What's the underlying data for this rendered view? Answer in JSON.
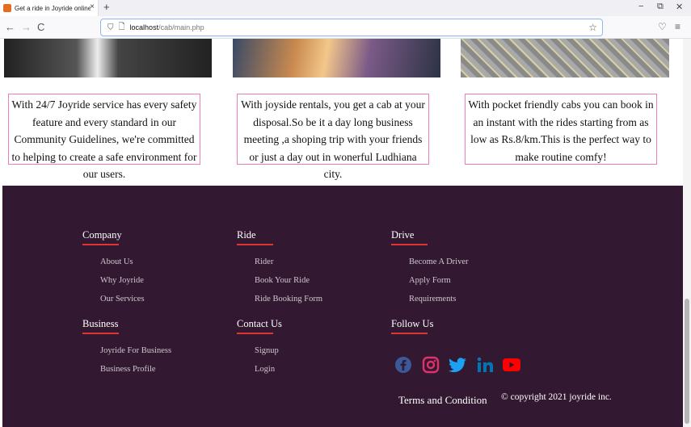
{
  "browser": {
    "tab_title": "Get a ride in Joyride online cab",
    "tab_close": "×",
    "new_tab": "+",
    "url_host": "localhost",
    "url_path": "/cab/main.php",
    "back": "←",
    "forward": "→",
    "reload": "C",
    "star": "☆",
    "minimize": "−",
    "restore": "⧉",
    "close": "✕",
    "pocket": "♡",
    "menu": "≡"
  },
  "cards": [
    {
      "text": "With 24/7 Joyride service has every safety feature and every standard in our Community Guidelines, we're committed to helping to create a safe environment for our users."
    },
    {
      "text": "With joyside rentals, you get a cab at your disposal.So be it a day long business meeting ,a shoping trip with your friends or just a day out in wonerful Ludhiana city."
    },
    {
      "text": "With pocket friendly cabs you can book in an instant with the rides starting from as low as Rs.8/km.This is the perfect way to make routine comfy!"
    }
  ],
  "footer": {
    "company": {
      "title": "Company",
      "links": [
        "About Us",
        "Why Joyride",
        "Our Services"
      ]
    },
    "ride": {
      "title": "Ride",
      "links": [
        "Rider",
        "Book Your Ride",
        "Ride Booking Form"
      ]
    },
    "drive": {
      "title": "Drive",
      "links": [
        "Become A Driver",
        "Apply Form",
        "Requirements"
      ]
    },
    "business": {
      "title": "Business",
      "links": [
        "Joyride For Business",
        "Business Profile"
      ]
    },
    "contact": {
      "title": "Contact Us",
      "links": [
        "Signup",
        "Login"
      ]
    },
    "follow": {
      "title": "Follow Us"
    },
    "social_icons": [
      "facebook-icon",
      "instagram-icon",
      "twitter-icon",
      "linkedin-icon",
      "youtube-icon"
    ],
    "social_colors": {
      "facebook": "#3b5998",
      "instagram": "#e1306c",
      "twitter": "#1da1f2",
      "linkedin": "#0077b5",
      "youtube": "#ff0000"
    },
    "terms": "Terms and Condition",
    "copyright": "© copyright 2021 joyride inc."
  },
  "colors": {
    "footer_bg": "#321830",
    "accent_line": "#e03535",
    "card_border": "#f07dbb"
  }
}
